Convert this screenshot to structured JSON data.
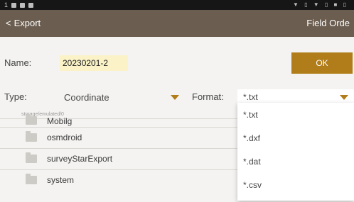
{
  "status_bar": {
    "time": "1",
    "right_icons": "▼ ▯ ▼ ▯ ■ ▯"
  },
  "app_bar": {
    "back_label": "Export",
    "right_label": "Field Orde"
  },
  "name_row": {
    "label": "Name:",
    "value": "20230201-2",
    "ok_label": "OK"
  },
  "type_row": {
    "type_label": "Type:",
    "type_value": "Coordinate",
    "format_label": "Format:",
    "format_value": "*.txt"
  },
  "path": "storage/emulated/0",
  "files": [
    "Mobilg",
    "osmdroid",
    "surveyStarExport",
    "system"
  ],
  "format_options": [
    "*.txt",
    "*.dxf",
    "*.dat",
    "*.csv"
  ],
  "colors": {
    "app_bar": "#6b5d4f",
    "accent": "#b07d1a",
    "name_input_bg": "#fbf3c7"
  }
}
